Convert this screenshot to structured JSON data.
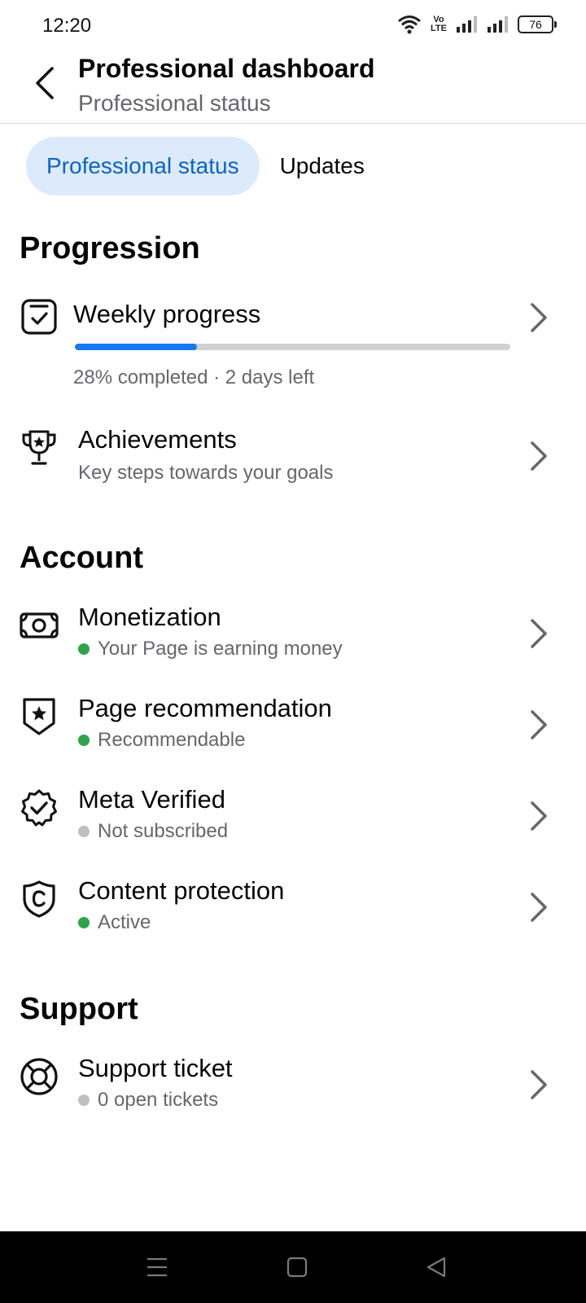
{
  "status_bar": {
    "time": "12:20",
    "battery": "76",
    "network_label": "Vo LTE",
    "icons": [
      "wifi-icon",
      "volte-icon",
      "signal-icon",
      "signal-icon",
      "battery-icon"
    ]
  },
  "header": {
    "title": "Professional dashboard",
    "subtitle": "Professional status",
    "back_icon": "chevron-left-icon"
  },
  "tabs": [
    {
      "label": "Professional status",
      "active": true
    },
    {
      "label": "Updates",
      "active": false
    }
  ],
  "sections": {
    "progression": {
      "title": "Progression",
      "weekly_progress": {
        "title": "Weekly progress",
        "progress_percent": 28,
        "subtitle": "28% completed · 2 days left",
        "icon": "checklist-icon"
      },
      "achievements": {
        "title": "Achievements",
        "subtitle": "Key steps towards your goals",
        "icon": "trophy-icon"
      }
    },
    "account": {
      "title": "Account",
      "items": [
        {
          "title": "Monetization",
          "status": "Your Page is earning money",
          "status_color": "#31a24c",
          "icon": "money-icon"
        },
        {
          "title": "Page recommendation",
          "status": "Recommendable",
          "status_color": "#31a24c",
          "icon": "star-badge-icon"
        },
        {
          "title": "Meta Verified",
          "status": "Not subscribed",
          "status_color": "#bcc0c4",
          "icon": "verified-badge-icon"
        },
        {
          "title": "Content protection",
          "status": "Active",
          "status_color": "#31a24c",
          "icon": "copyright-shield-icon"
        }
      ]
    },
    "support": {
      "title": "Support",
      "items": [
        {
          "title": "Support ticket",
          "status": "0 open tickets",
          "status_color": "#bcc0c4",
          "icon": "lifebuoy-icon"
        }
      ]
    }
  },
  "nav_bar": {
    "icons": [
      "menu-icon",
      "home-square-icon",
      "back-triangle-icon"
    ]
  },
  "colors": {
    "accent": "#1877f2",
    "tab_active_bg": "#ddeafb",
    "tab_active_text": "#0a66c2",
    "active_status": "#31a24c",
    "inactive_status": "#bcc0c4"
  }
}
